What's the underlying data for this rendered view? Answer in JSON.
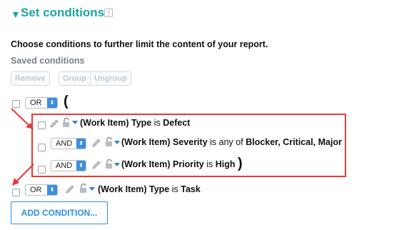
{
  "header": {
    "title": "Set conditions",
    "help_glyph": "?"
  },
  "intro": "Choose conditions to further limit the content of your report.",
  "saved_conditions_label": "Saved conditions",
  "toolbar": {
    "remove_label": "Remove",
    "group_label": "Group",
    "ungroup_label": "Ungroup"
  },
  "group": {
    "operator": "OR",
    "open_paren": "(",
    "close_paren": ")"
  },
  "conditions": [
    {
      "field": "(Work Item) Type",
      "verb": "is",
      "value": "Defect"
    },
    {
      "operator": "AND",
      "field": "(Work Item) Severity",
      "verb": "is any of",
      "value": "Blocker, Critical, Major"
    },
    {
      "operator": "AND",
      "field": "(Work Item) Priority",
      "verb": "is",
      "value": "High"
    }
  ],
  "last_condition": {
    "operator": "OR",
    "field": "(Work Item) Type",
    "verb": "is",
    "value": "Task"
  },
  "add_condition_label": "ADD CONDITION...",
  "colors": {
    "accent": "#1ba7a0",
    "select_arrow": "#3c8fe0",
    "annotation_red": "#e23b3b",
    "add_button": "#2d8fe0"
  }
}
